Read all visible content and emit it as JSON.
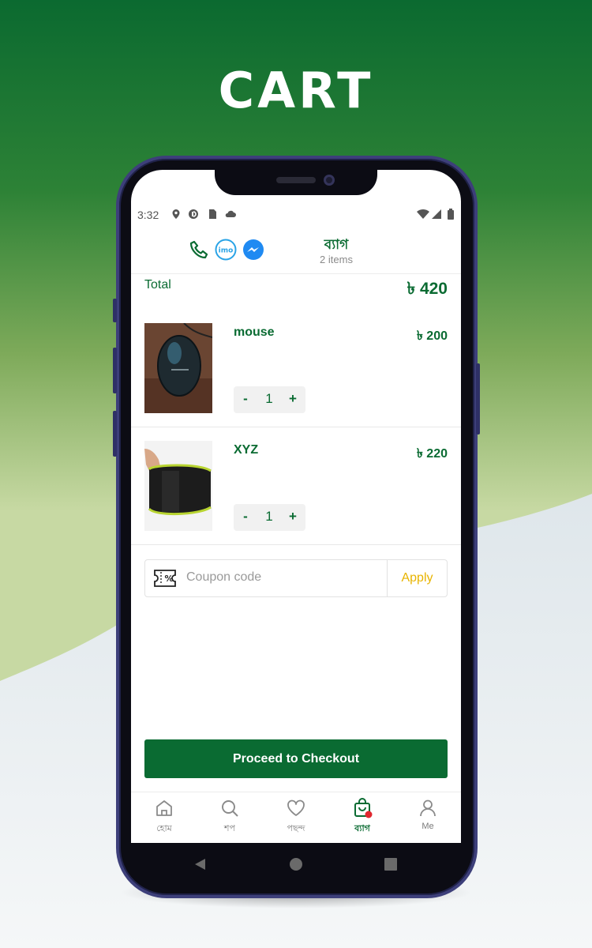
{
  "promo": {
    "title": "CART"
  },
  "status_bar": {
    "time": "3:32"
  },
  "header": {
    "title": "ব্যাগ",
    "subtitle": "2 items",
    "contact_icons": [
      "phone-icon",
      "imo-icon",
      "messenger-icon"
    ],
    "imo_text": "imo"
  },
  "cart": {
    "total_label": "Total",
    "total_value": "৳ 420",
    "items": [
      {
        "name": "mouse",
        "price": "৳ 200",
        "quantity": "1"
      },
      {
        "name": "XYZ",
        "price": "৳ 220",
        "quantity": "1"
      }
    ],
    "minus": "-",
    "plus": "+"
  },
  "coupon": {
    "placeholder": "Coupon code",
    "apply_label": "Apply"
  },
  "checkout": {
    "label": "Proceed to Checkout"
  },
  "tabs": [
    {
      "label": "হোম",
      "icon": "home-icon",
      "active": false
    },
    {
      "label": "শপ",
      "icon": "search-icon",
      "active": false
    },
    {
      "label": "পছন্দ",
      "icon": "heart-icon",
      "active": false
    },
    {
      "label": "ব্যাগ",
      "icon": "bag-icon",
      "active": true
    },
    {
      "label": "Me",
      "icon": "user-icon",
      "active": false
    }
  ],
  "colors": {
    "primary": "#0a6b32",
    "accent": "#e8b400",
    "badge": "#e0262e"
  }
}
